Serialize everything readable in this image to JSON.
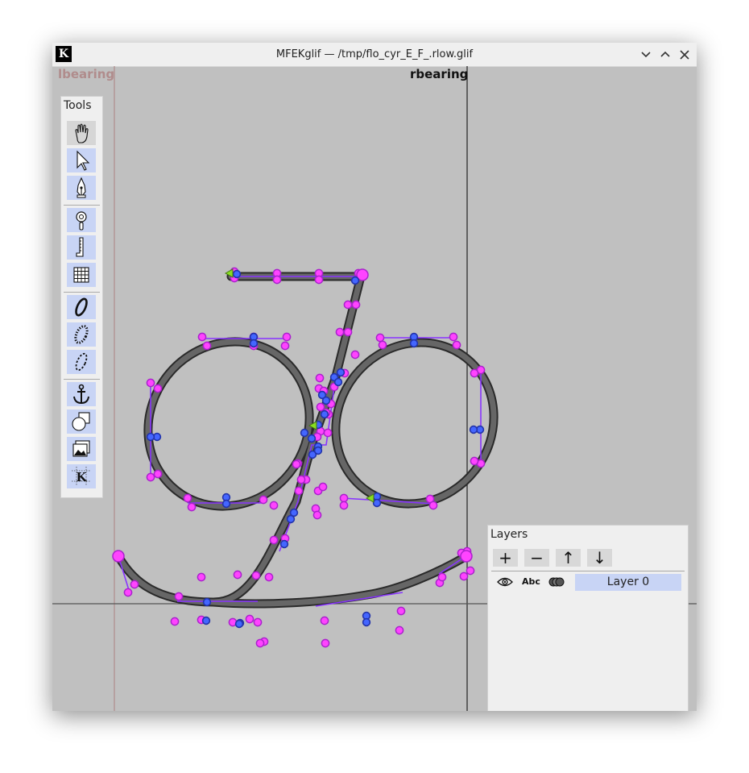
{
  "window": {
    "title": "MFEKglif — /tmp/flo_cyr_E_F_.rlow.glif",
    "app_icon": "K",
    "controls": [
      "minimize-icon",
      "maximize-icon",
      "close-icon"
    ]
  },
  "canvas": {
    "lbearing_label": "lbearing",
    "rbearing_label": "rbearing",
    "colors": {
      "background": "#c0c0c0",
      "outline": "#555555",
      "handle": "#ff44ff",
      "on_curve_point": "#4466ff",
      "handle_line": "#8833ff",
      "start_point": "#88dd22",
      "lbearing_line": "#b08c8c",
      "rbearing_line": "#222222"
    }
  },
  "tools": {
    "title": "Tools",
    "items": [
      {
        "icon": "hand-pan-icon",
        "active": true
      },
      {
        "icon": "select-arrow-icon",
        "active": false
      },
      {
        "icon": "pen-nib-icon",
        "active": false
      },
      {
        "icon": "zoom-magnifier-icon",
        "active": false
      },
      {
        "icon": "measure-ruler-icon",
        "active": false
      },
      {
        "icon": "grid-icon",
        "active": false
      },
      {
        "icon": "variable-width-stroke-icon",
        "active": false
      },
      {
        "icon": "pattern-along-path-icon",
        "active": false
      },
      {
        "icon": "dash-stroke-icon",
        "active": false
      },
      {
        "icon": "anchor-icon",
        "active": false
      },
      {
        "icon": "shapes-icon",
        "active": false
      },
      {
        "icon": "image-icon",
        "active": false
      },
      {
        "icon": "guidelines-icon",
        "active": false
      }
    ]
  },
  "layers": {
    "title": "Layers",
    "buttons": [
      "+",
      "−",
      "↑",
      "↓"
    ],
    "rows": [
      {
        "name": "Layer 0",
        "visibility_icon": "eye-icon",
        "type_label": "Abc",
        "combine_icon": "combine-icon"
      }
    ]
  }
}
